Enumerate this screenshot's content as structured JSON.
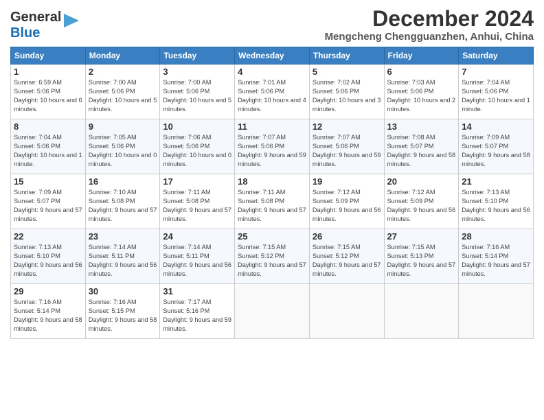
{
  "header": {
    "logo_line1": "General",
    "logo_line2": "Blue",
    "month": "December 2024",
    "location": "Mengcheng Chengguanzhen, Anhui, China"
  },
  "days_of_week": [
    "Sunday",
    "Monday",
    "Tuesday",
    "Wednesday",
    "Thursday",
    "Friday",
    "Saturday"
  ],
  "weeks": [
    [
      {
        "day": "1",
        "sunrise": "6:59 AM",
        "sunset": "5:06 PM",
        "daylight": "10 hours and 6 minutes."
      },
      {
        "day": "2",
        "sunrise": "7:00 AM",
        "sunset": "5:06 PM",
        "daylight": "10 hours and 5 minutes."
      },
      {
        "day": "3",
        "sunrise": "7:00 AM",
        "sunset": "5:06 PM",
        "daylight": "10 hours and 5 minutes."
      },
      {
        "day": "4",
        "sunrise": "7:01 AM",
        "sunset": "5:06 PM",
        "daylight": "10 hours and 4 minutes."
      },
      {
        "day": "5",
        "sunrise": "7:02 AM",
        "sunset": "5:06 PM",
        "daylight": "10 hours and 3 minutes."
      },
      {
        "day": "6",
        "sunrise": "7:03 AM",
        "sunset": "5:06 PM",
        "daylight": "10 hours and 2 minutes."
      },
      {
        "day": "7",
        "sunrise": "7:04 AM",
        "sunset": "5:06 PM",
        "daylight": "10 hours and 1 minute."
      }
    ],
    [
      {
        "day": "8",
        "sunrise": "7:04 AM",
        "sunset": "5:06 PM",
        "daylight": "10 hours and 1 minute."
      },
      {
        "day": "9",
        "sunrise": "7:05 AM",
        "sunset": "5:06 PM",
        "daylight": "10 hours and 0 minutes."
      },
      {
        "day": "10",
        "sunrise": "7:06 AM",
        "sunset": "5:06 PM",
        "daylight": "10 hours and 0 minutes."
      },
      {
        "day": "11",
        "sunrise": "7:07 AM",
        "sunset": "5:06 PM",
        "daylight": "9 hours and 59 minutes."
      },
      {
        "day": "12",
        "sunrise": "7:07 AM",
        "sunset": "5:06 PM",
        "daylight": "9 hours and 59 minutes."
      },
      {
        "day": "13",
        "sunrise": "7:08 AM",
        "sunset": "5:07 PM",
        "daylight": "9 hours and 58 minutes."
      },
      {
        "day": "14",
        "sunrise": "7:09 AM",
        "sunset": "5:07 PM",
        "daylight": "9 hours and 58 minutes."
      }
    ],
    [
      {
        "day": "15",
        "sunrise": "7:09 AM",
        "sunset": "5:07 PM",
        "daylight": "9 hours and 57 minutes."
      },
      {
        "day": "16",
        "sunrise": "7:10 AM",
        "sunset": "5:08 PM",
        "daylight": "9 hours and 57 minutes."
      },
      {
        "day": "17",
        "sunrise": "7:11 AM",
        "sunset": "5:08 PM",
        "daylight": "9 hours and 57 minutes."
      },
      {
        "day": "18",
        "sunrise": "7:11 AM",
        "sunset": "5:08 PM",
        "daylight": "9 hours and 57 minutes."
      },
      {
        "day": "19",
        "sunrise": "7:12 AM",
        "sunset": "5:09 PM",
        "daylight": "9 hours and 56 minutes."
      },
      {
        "day": "20",
        "sunrise": "7:12 AM",
        "sunset": "5:09 PM",
        "daylight": "9 hours and 56 minutes."
      },
      {
        "day": "21",
        "sunrise": "7:13 AM",
        "sunset": "5:10 PM",
        "daylight": "9 hours and 56 minutes."
      }
    ],
    [
      {
        "day": "22",
        "sunrise": "7:13 AM",
        "sunset": "5:10 PM",
        "daylight": "9 hours and 56 minutes."
      },
      {
        "day": "23",
        "sunrise": "7:14 AM",
        "sunset": "5:11 PM",
        "daylight": "9 hours and 56 minutes."
      },
      {
        "day": "24",
        "sunrise": "7:14 AM",
        "sunset": "5:11 PM",
        "daylight": "9 hours and 56 minutes."
      },
      {
        "day": "25",
        "sunrise": "7:15 AM",
        "sunset": "5:12 PM",
        "daylight": "9 hours and 57 minutes."
      },
      {
        "day": "26",
        "sunrise": "7:15 AM",
        "sunset": "5:12 PM",
        "daylight": "9 hours and 57 minutes."
      },
      {
        "day": "27",
        "sunrise": "7:15 AM",
        "sunset": "5:13 PM",
        "daylight": "9 hours and 57 minutes."
      },
      {
        "day": "28",
        "sunrise": "7:16 AM",
        "sunset": "5:14 PM",
        "daylight": "9 hours and 57 minutes."
      }
    ],
    [
      {
        "day": "29",
        "sunrise": "7:16 AM",
        "sunset": "5:14 PM",
        "daylight": "9 hours and 58 minutes."
      },
      {
        "day": "30",
        "sunrise": "7:16 AM",
        "sunset": "5:15 PM",
        "daylight": "9 hours and 58 minutes."
      },
      {
        "day": "31",
        "sunrise": "7:17 AM",
        "sunset": "5:16 PM",
        "daylight": "9 hours and 59 minutes."
      },
      null,
      null,
      null,
      null
    ]
  ]
}
